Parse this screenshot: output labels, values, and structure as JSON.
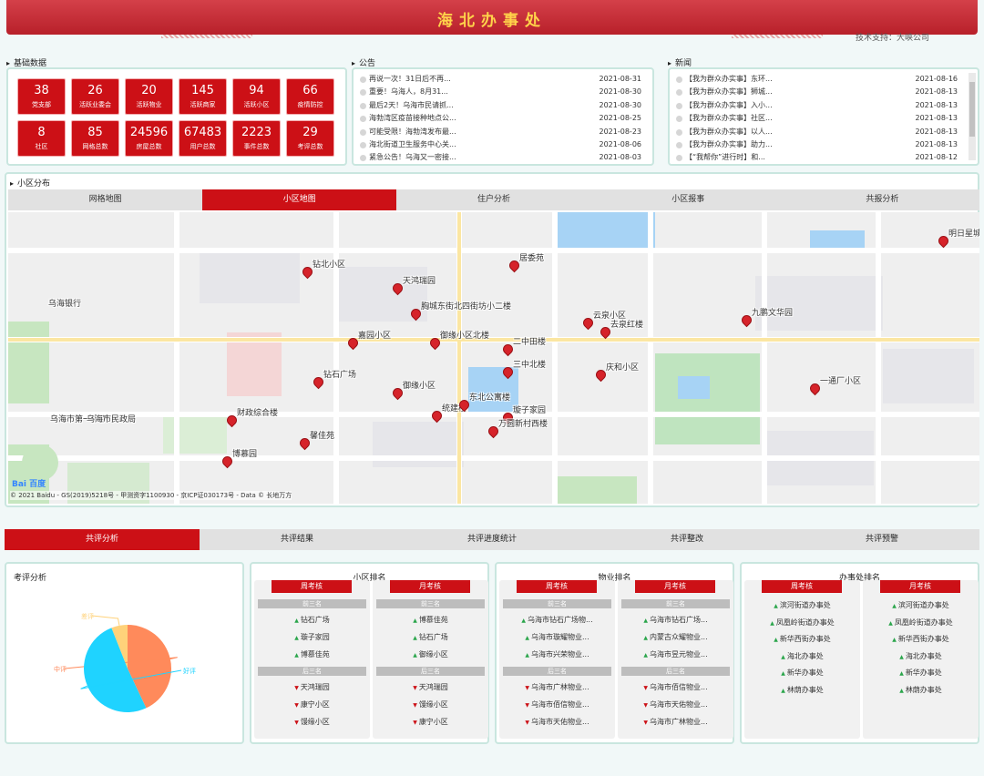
{
  "header": {
    "title": "海北办事处",
    "support": "技术支持：大峡公司"
  },
  "stats": {
    "label": "基础数据",
    "items": [
      {
        "num": "38",
        "lbl": "党支部"
      },
      {
        "num": "26",
        "lbl": "活跃业委会"
      },
      {
        "num": "20",
        "lbl": "活跃物业"
      },
      {
        "num": "145",
        "lbl": "活跃商家"
      },
      {
        "num": "94",
        "lbl": "活跃小区"
      },
      {
        "num": "66",
        "lbl": "疫情防控"
      },
      {
        "num": "8",
        "lbl": "社区"
      },
      {
        "num": "85",
        "lbl": "网格总数"
      },
      {
        "num": "24596",
        "lbl": "房屋总数"
      },
      {
        "num": "67483",
        "lbl": "用户总数"
      },
      {
        "num": "2223",
        "lbl": "事件总数"
      },
      {
        "num": "29",
        "lbl": "考评总数"
      }
    ]
  },
  "notice": {
    "label": "公告",
    "rows": [
      {
        "t": "再说一次！31日后不再...",
        "d": "2021-08-31"
      },
      {
        "t": "重要！乌海人，8月31...",
        "d": "2021-08-30"
      },
      {
        "t": "最后2天！乌海市民请抓...",
        "d": "2021-08-30"
      },
      {
        "t": "海勃湾区疫苗接种地点公...",
        "d": "2021-08-25"
      },
      {
        "t": "可能受限！海勃湾发布最...",
        "d": "2021-08-23"
      },
      {
        "t": "海北街道卫生服务中心关...",
        "d": "2021-08-06"
      },
      {
        "t": "紧急公告！乌海又一密接...",
        "d": "2021-08-03"
      }
    ]
  },
  "news": {
    "label": "新闻",
    "rows": [
      {
        "t": "【我为群众办实事】东环...",
        "d": "2021-08-16"
      },
      {
        "t": "【我为群众办实事】狮城...",
        "d": "2021-08-13"
      },
      {
        "t": "【我为群众办实事】入小...",
        "d": "2021-08-13"
      },
      {
        "t": "【我为群众办实事】社区...",
        "d": "2021-08-13"
      },
      {
        "t": "【我为群众办实事】以人...",
        "d": "2021-08-13"
      },
      {
        "t": "【我为群众办实事】助力...",
        "d": "2021-08-13"
      },
      {
        "t": "【“我帮你”进行时】和...",
        "d": "2021-08-12"
      }
    ]
  },
  "map_section": {
    "label": "小区分布",
    "tabs": [
      "网格地图",
      "小区地图",
      "住户分析",
      "小区报事",
      "共报分析"
    ],
    "credit": "© 2021 Baidu - GS(2019)5218号 - 甲测资字1100930 - 京ICP证030173号 - Data © 长地万方",
    "baidu": "Bai 百度",
    "labels": [
      "钻北小区",
      "天鸿瑞园",
      "胸城东街北四街坊小二楼",
      "嘉园小区",
      "御缘小区北楼",
      "钻石广场",
      "御缘小区",
      "财政综合楼",
      "馨佳苑",
      "博慕园",
      "统建楼",
      "东北公寓楼",
      "璇子家园",
      "万圆新村西楼",
      "三中北楼",
      "二中田楼",
      "居委苑",
      "云泉小区",
      "去泉红楼",
      "庆和小区",
      "九鹏文华园",
      "一通厂小区",
      "明日星城",
      "乌海银行",
      "乌海市第一中学",
      "乌海市民政局"
    ]
  },
  "bottom": {
    "tabs": [
      "共评分析",
      "共评结果",
      "共评进度统计",
      "共评整改",
      "共评预警"
    ],
    "eval": {
      "title": "考评分析",
      "legend": [
        "差评",
        "中评",
        "好评"
      ]
    },
    "rank_cards": [
      {
        "title": "小区排名",
        "week": {
          "head": "周考核",
          "top_label": "前三名",
          "top": [
            "钻石广场",
            "璇子家园",
            "博慕佳苑"
          ],
          "bottom_label": "后三名",
          "bottom": [
            "天鸿瑞园",
            "康宁小区",
            "馒缘小区"
          ]
        },
        "month": {
          "head": "月考核",
          "top_label": "前三名",
          "top": [
            "博慕佳苑",
            "钻石广场",
            "御缘小区"
          ],
          "bottom_label": "后三名",
          "bottom": [
            "天鸿瑞园",
            "馒缘小区",
            "康宁小区"
          ]
        }
      },
      {
        "title": "物业排名",
        "week": {
          "head": "周考核",
          "top_label": "前三名",
          "top": [
            "乌海市钻石广场物...",
            "乌海市璇耀物业...",
            "乌海市兴荣物业..."
          ],
          "bottom_label": "后三名",
          "bottom": [
            "乌海市广林物业...",
            "乌海市佰信物业...",
            "乌海市天佑物业..."
          ]
        },
        "month": {
          "head": "月考核",
          "top_label": "前三名",
          "top": [
            "乌海市钻石广场...",
            "内蒙古众耀物业...",
            "乌海市昱元物业..."
          ],
          "bottom_label": "后三名",
          "bottom": [
            "乌海市佰信物业...",
            "乌海市天佑物业...",
            "乌海市广林物业..."
          ]
        }
      }
    ],
    "office_card": {
      "title": "办事处排名",
      "week": {
        "head": "周考核",
        "items": [
          "滨河街道办事处",
          "凤凰岭街道办事处",
          "新华西街办事处",
          "海北办事处",
          "新华办事处",
          "林荫办事处"
        ]
      },
      "month": {
        "head": "月考核",
        "items": [
          "滨河街道办事处",
          "凤凰岭街道办事处",
          "新华西街办事处",
          "海北办事处",
          "新华办事处",
          "林荫办事处"
        ]
      }
    }
  },
  "pie": {
    "values": [
      6,
      43,
      51
    ],
    "colors": [
      "#ffd27a",
      "#ff8a5b",
      "#1fd3ff"
    ]
  },
  "colors": {
    "accent": "#cc1016",
    "panel_border": "#c9e6df"
  }
}
